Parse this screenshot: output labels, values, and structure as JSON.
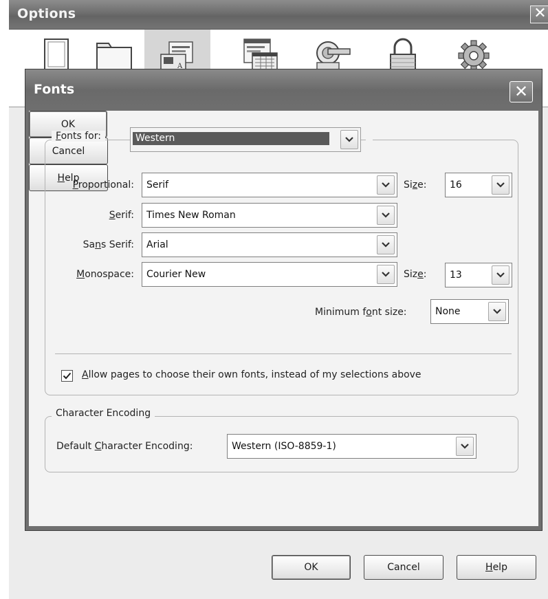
{
  "options_window": {
    "title": "Options",
    "close_glyph": "✕",
    "toolbar_icons": [
      "main-icon",
      "tabs-icon",
      "content-icon",
      "applications-icon",
      "privacy-icon",
      "security-icon",
      "advanced-gear-icon"
    ],
    "selected_pane_index": 2,
    "footer": {
      "ok_label": "OK",
      "cancel_label": "Cancel",
      "help_label": "Help",
      "help_accel": "H",
      "help_rest": "elp"
    }
  },
  "fonts_dialog": {
    "title": "Fonts",
    "close_glyph": "✕",
    "fonts_for": {
      "label_accel": "F",
      "label_rest": "onts for:",
      "value": "Western"
    },
    "rows": {
      "proportional": {
        "accel": "P",
        "rest": "roportional:",
        "value": "Serif"
      },
      "serif": {
        "accel": "S",
        "rest": "erif:",
        "value": "Times New Roman"
      },
      "sans_serif": {
        "before": "Sa",
        "accel": "n",
        "after": "s Serif:",
        "value": "Arial"
      },
      "monospace": {
        "accel": "M",
        "rest": "onospace:",
        "value": "Courier New"
      }
    },
    "proportional_size": {
      "before": "Si",
      "accel": "z",
      "after": "e:",
      "value": "16"
    },
    "monospace_size": {
      "before": "Siz",
      "accel": "e",
      "after": ":",
      "value": "13"
    },
    "minimum_font_size": {
      "before": "Minimum f",
      "accel": "o",
      "after": "nt size:",
      "value": "None"
    },
    "allow_pages": {
      "checked": true,
      "accel": "A",
      "rest": "llow pages to choose their own fonts, instead of my selections above"
    },
    "character_encoding": {
      "legend": "Character Encoding",
      "label_before": "Default ",
      "label_accel": "C",
      "label_after": "haracter Encoding:",
      "value": "Western (ISO-8859-1)"
    },
    "buttons": {
      "ok_label": "OK",
      "cancel_label": "Cancel",
      "help_accel": "H",
      "help_rest": "elp"
    }
  },
  "colors": {
    "titlebar": "#6f6f6f",
    "dialog_face": "#f3f3f3",
    "selection": "#5a5a5a"
  }
}
